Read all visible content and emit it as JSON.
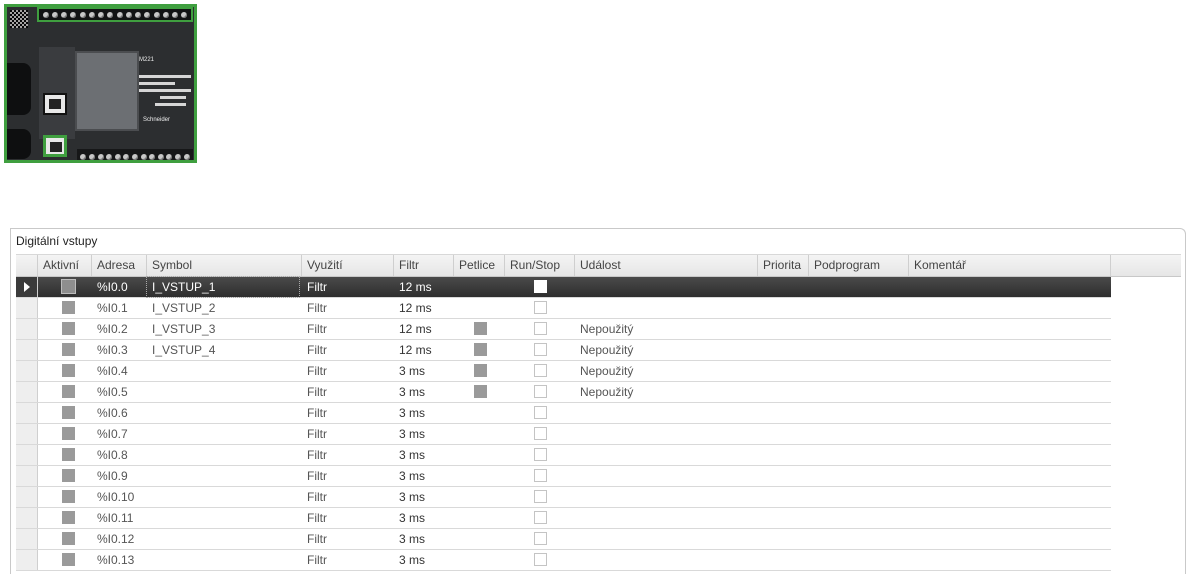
{
  "device": {
    "brand": "Schneider",
    "model": "M221"
  },
  "group_title": "Digitální vstupy",
  "columns": {
    "aktivni": "Aktivní",
    "adresa": "Adresa",
    "symbol": "Symbol",
    "vyuziti": "Využití",
    "filtr": "Filtr",
    "petlice": "Petlice",
    "runstop": "Run/Stop",
    "udalost": "Událost",
    "priorita": "Priorita",
    "podprogram": "Podprogram",
    "komentar": "Komentář"
  },
  "rows": [
    {
      "adresa": "%I0.0",
      "symbol": "I_VSTUP_1",
      "vyuziti": "Filtr",
      "filtr": "12 ms",
      "latch": false,
      "udalost": "",
      "selected": true
    },
    {
      "adresa": "%I0.1",
      "symbol": "I_VSTUP_2",
      "vyuziti": "Filtr",
      "filtr": "12 ms",
      "latch": false,
      "udalost": ""
    },
    {
      "adresa": "%I0.2",
      "symbol": "I_VSTUP_3",
      "vyuziti": "Filtr",
      "filtr": "12 ms",
      "latch": true,
      "udalost": "Nepoužitý"
    },
    {
      "adresa": "%I0.3",
      "symbol": "I_VSTUP_4",
      "vyuziti": "Filtr",
      "filtr": "12 ms",
      "latch": true,
      "udalost": "Nepoužitý"
    },
    {
      "adresa": "%I0.4",
      "symbol": "",
      "vyuziti": "Filtr",
      "filtr": "3 ms",
      "latch": true,
      "udalost": "Nepoužitý"
    },
    {
      "adresa": "%I0.5",
      "symbol": "",
      "vyuziti": "Filtr",
      "filtr": "3 ms",
      "latch": true,
      "udalost": "Nepoužitý"
    },
    {
      "adresa": "%I0.6",
      "symbol": "",
      "vyuziti": "Filtr",
      "filtr": "3 ms",
      "latch": false,
      "udalost": ""
    },
    {
      "adresa": "%I0.7",
      "symbol": "",
      "vyuziti": "Filtr",
      "filtr": "3 ms",
      "latch": false,
      "udalost": ""
    },
    {
      "adresa": "%I0.8",
      "symbol": "",
      "vyuziti": "Filtr",
      "filtr": "3 ms",
      "latch": false,
      "udalost": ""
    },
    {
      "adresa": "%I0.9",
      "symbol": "",
      "vyuziti": "Filtr",
      "filtr": "3 ms",
      "latch": false,
      "udalost": ""
    },
    {
      "adresa": "%I0.10",
      "symbol": "",
      "vyuziti": "Filtr",
      "filtr": "3 ms",
      "latch": false,
      "udalost": ""
    },
    {
      "adresa": "%I0.11",
      "symbol": "",
      "vyuziti": "Filtr",
      "filtr": "3 ms",
      "latch": false,
      "udalost": ""
    },
    {
      "adresa": "%I0.12",
      "symbol": "",
      "vyuziti": "Filtr",
      "filtr": "3 ms",
      "latch": false,
      "udalost": ""
    },
    {
      "adresa": "%I0.13",
      "symbol": "",
      "vyuziti": "Filtr",
      "filtr": "3 ms",
      "latch": false,
      "udalost": ""
    }
  ]
}
